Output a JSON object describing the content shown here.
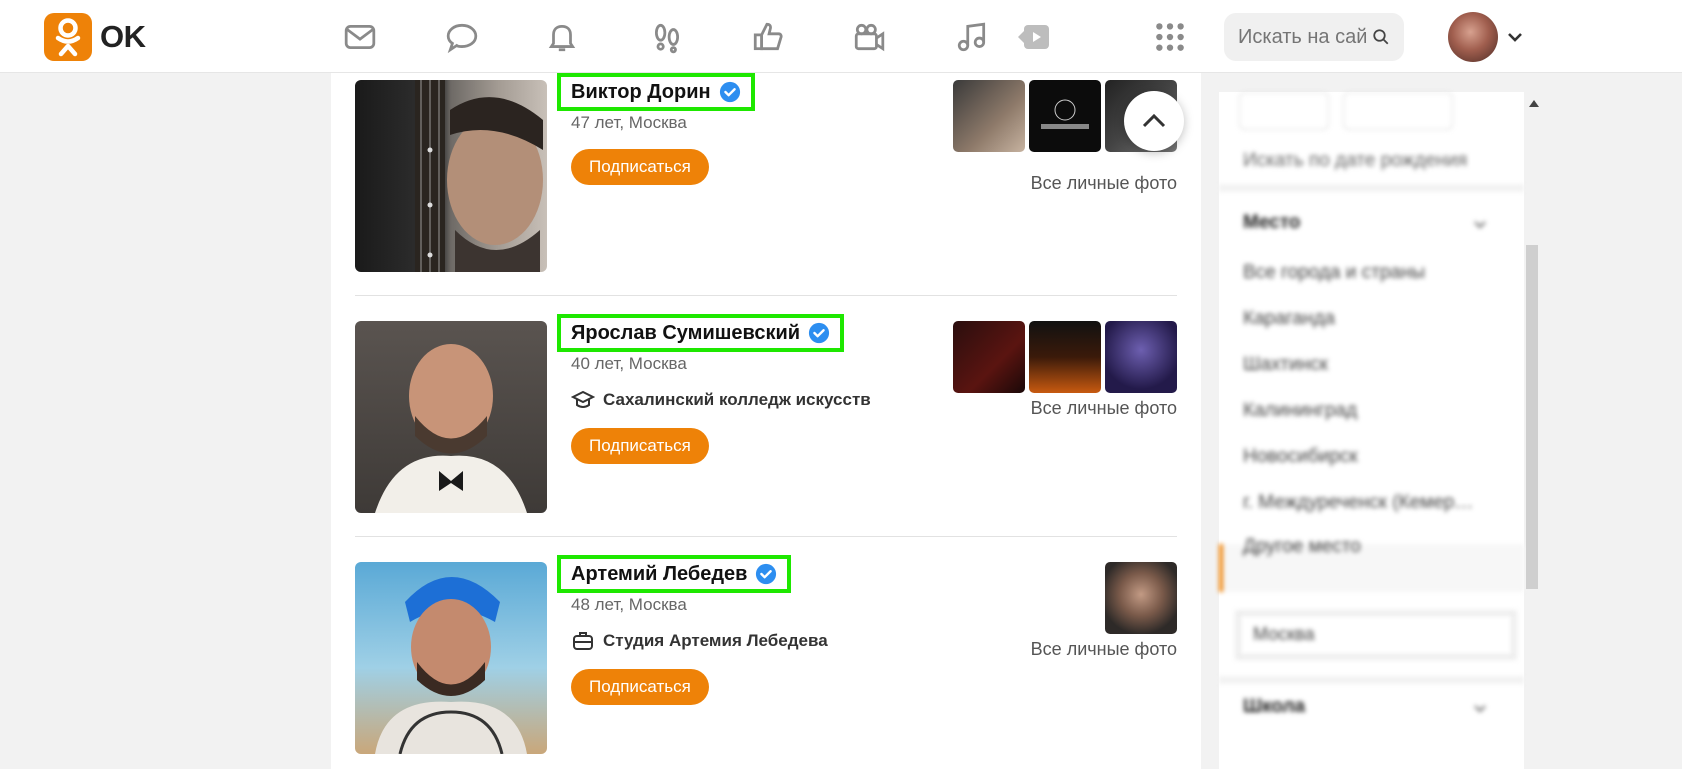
{
  "header": {
    "logo_text": "OK",
    "search_placeholder": "Искать на сайте",
    "brand_color": "#ee8208",
    "nav": [
      "messages-icon",
      "discussions-icon",
      "notifications-icon",
      "guests-icon",
      "likes-icon",
      "video-calls-icon",
      "music-icon",
      "video-icon",
      "apps-grid-icon"
    ]
  },
  "people": [
    {
      "name": "Виктор Дорин",
      "meta": "47 лет, Москва",
      "extra": null,
      "subscribe_label": "Подписаться",
      "all_photos_label": "Все личные фото"
    },
    {
      "name": "Ярослав Сумишевский",
      "meta": "40 лет, Москва",
      "extra": "Сахалинский колледж искусств",
      "extra_icon": "graduation-cap-icon",
      "subscribe_label": "Подписаться",
      "all_photos_label": "Все личные фото"
    },
    {
      "name": "Артемий Лебедев",
      "meta": "48 лет, Москва",
      "extra": "Студия Артемия Лебедева",
      "extra_icon": "briefcase-icon",
      "subscribe_label": "Подписаться",
      "all_photos_label": "Все личные фото"
    }
  ],
  "sidebar": {
    "birthday_search": "Искать по дате рождения",
    "place_header": "Место",
    "places": [
      "Все города и страны",
      "Караганда",
      "Шахтинск",
      "Калининград",
      "Новосибирск",
      "г. Междуреченск (Кемер…"
    ],
    "other_place": "Другое место",
    "place_input_value": "Москва",
    "school_header": "Школа"
  }
}
